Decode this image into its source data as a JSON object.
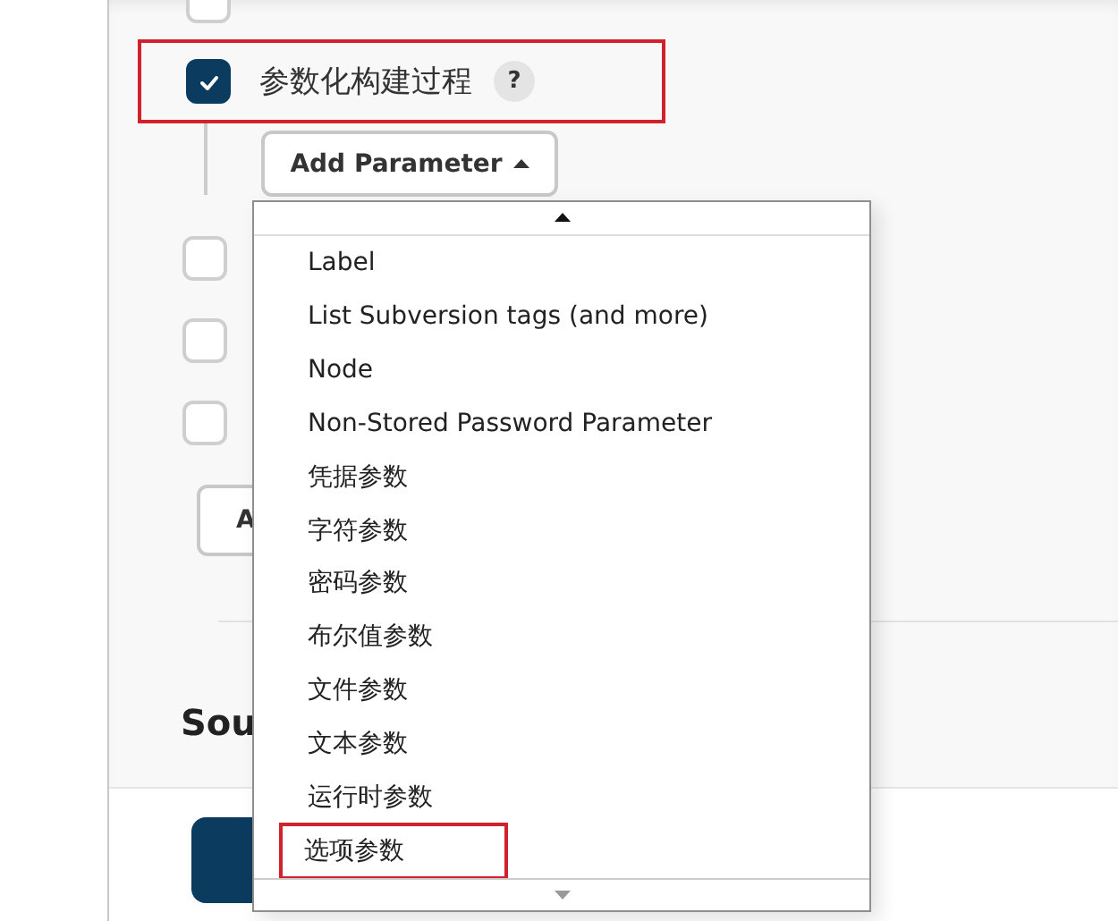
{
  "options": [
    {
      "checked": false,
      "highlighted": false
    },
    {
      "label": "参数化构建过程",
      "help": "?",
      "checked": true,
      "highlighted": true
    }
  ],
  "add_parameter_button": {
    "label": "Add Parameter"
  },
  "more_options": [
    {
      "checked": false
    },
    {
      "checked": false
    },
    {
      "checked": false
    }
  ],
  "advanced_button": {
    "label": "A"
  },
  "section_heading": "Sou",
  "menu": {
    "items": [
      {
        "label": "Label",
        "highlighted": false
      },
      {
        "label": "List Subversion tags (and more)",
        "highlighted": false
      },
      {
        "label": "Node",
        "highlighted": false
      },
      {
        "label": "Non-Stored Password Parameter",
        "highlighted": false
      },
      {
        "label": "凭据参数",
        "highlighted": false
      },
      {
        "label": "字符参数",
        "highlighted": false
      },
      {
        "label": "密码参数",
        "highlighted": false
      },
      {
        "label": "布尔值参数",
        "highlighted": false
      },
      {
        "label": "文件参数",
        "highlighted": false
      },
      {
        "label": "文本参数",
        "highlighted": false
      },
      {
        "label": "运行时参数",
        "highlighted": false
      },
      {
        "label": "选项参数",
        "highlighted": true
      }
    ]
  }
}
